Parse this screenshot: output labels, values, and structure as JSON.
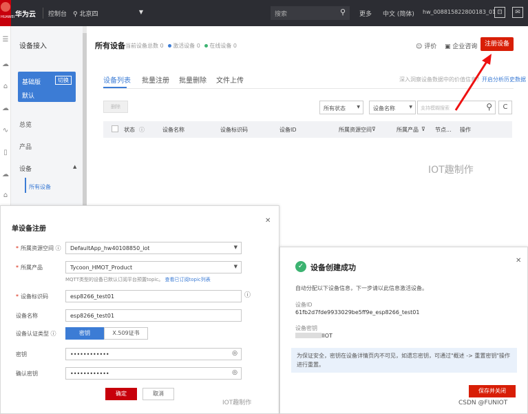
{
  "topbar": {
    "logo_text": "HUAWEI",
    "brand": "华为云",
    "console": "控制台",
    "region": "北京四",
    "search_placeholder": "搜索",
    "more": "更多",
    "language": "中文 (简体)",
    "user": "hw_008815822800183_01"
  },
  "sidebar": {
    "title": "设备接入",
    "edition_label": "基础版",
    "edition_switch": "切换",
    "edition_sub": "默认",
    "items": [
      "总览",
      "产品",
      "设备",
      "所有设备"
    ]
  },
  "main": {
    "title": "所有设备",
    "stats": [
      "当前设备总数 0",
      "激活设备 0",
      "在线设备 0"
    ],
    "stat_colors": [
      "#999999",
      "#3c7cd5",
      "#3cb371"
    ],
    "actions": [
      "评价",
      "企业咨询"
    ],
    "register_button": "注册设备",
    "tabs": [
      "设备列表",
      "批量注册",
      "批量删除",
      "文件上传"
    ],
    "tip_text": "深入洞察设备数据中的价值信息？",
    "tip_link": "开启分析历史数据",
    "delete_button": "删除",
    "filter_status": "所有状态",
    "filter_field": "设备名称",
    "filter_placeholder": "支持模糊搜索",
    "columns": [
      "状态",
      "设备名称",
      "设备标识码",
      "设备ID",
      "所属资源空间",
      "所属产品",
      "节点...",
      "操作"
    ]
  },
  "watermark": "IOT趣制作",
  "register_dialog": {
    "title": "单设备注册",
    "labels": {
      "space": "所属资源空间",
      "product": "所属产品",
      "identifier": "设备标识码",
      "name": "设备名称",
      "auth": "设备认证类型",
      "secret": "密钥",
      "confirm_secret": "确认密钥"
    },
    "values": {
      "space": "DefaultApp_hw40108850_iot",
      "product": "Tycoon_HMOT_Product",
      "identifier": "esp8266_test01",
      "name": "esp8266_test01",
      "secret": "••••••••••••",
      "confirm_secret": "••••••••••••"
    },
    "mqtt_hint": "MQTT类型的设备已默认订阅平台预置topic。",
    "mqtt_link": "查看已订阅topic列表",
    "auth_options": [
      "密钥",
      "X.509证书"
    ],
    "confirm": "确定",
    "cancel": "取消"
  },
  "success_dialog": {
    "title": "设备创建成功",
    "desc": "自动分配以下设备信息，下一步请以此信息激活设备。",
    "device_id_label": "设备ID",
    "device_id": "61fb2d7fde9933029be5ff9e_esp8266_test01",
    "secret_label": "设备密钥",
    "secret_value": "IIOT",
    "note": "为保证安全，密钥在设备详情页内不可见，如遗忘密钥，可通过\"概述 -> 重置密钥\"操作进行重置。",
    "save_button": "保存并关闭"
  },
  "footer": "CSDN @FUNIOT"
}
